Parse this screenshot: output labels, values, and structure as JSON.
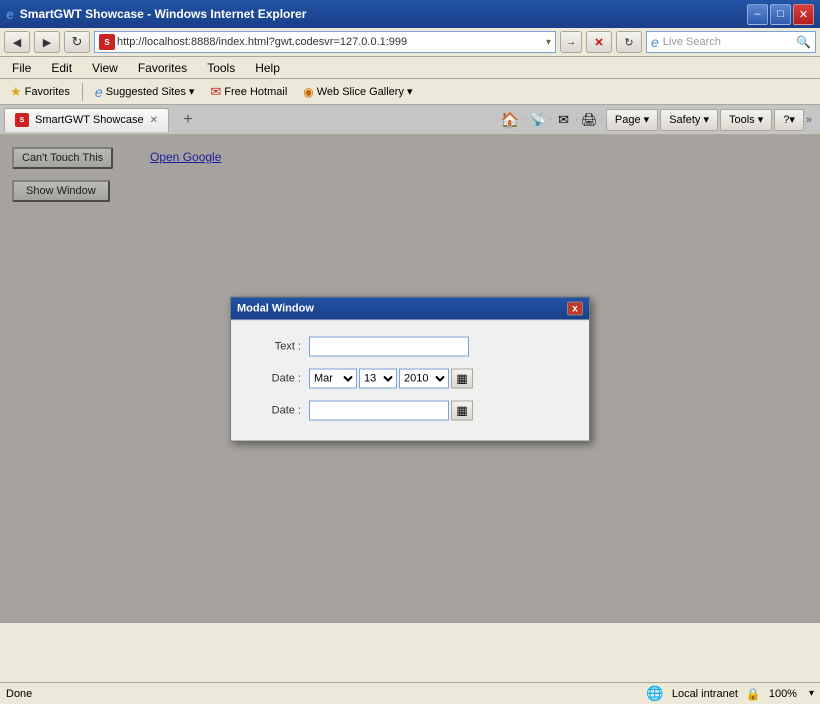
{
  "titlebar": {
    "title": "SmartGWT Showcase - Windows Internet Explorer",
    "controls": {
      "minimize": "–",
      "maximize": "□",
      "close": "✕"
    }
  },
  "addressbar": {
    "back_icon": "◀",
    "forward_icon": "▶",
    "refresh_icon": "↻",
    "url": "http://localhost:8888/index.html?gwt.codesvr=127.0.0.1:999",
    "search_placeholder": "Live Search",
    "go_icon": "🔍"
  },
  "menubar": {
    "items": [
      "File",
      "Edit",
      "View",
      "Favorites",
      "Tools",
      "Help"
    ]
  },
  "favoritesbar": {
    "favorites_label": "Favorites",
    "suggested_sites": "Suggested Sites ▾",
    "free_hotmail": "Free Hotmail",
    "web_slice_gallery": "Web Slice Gallery ▾"
  },
  "tab": {
    "label": "SmartGWT Showcase",
    "new_tab": "+"
  },
  "toolbar_buttons": [
    "Page ▾",
    "Safety ▾",
    "Tools ▾",
    "?▾"
  ],
  "page": {
    "cant_touch_label": "Can't Touch This",
    "open_google_label": "Open Google",
    "show_window_label": "Show Window"
  },
  "modal": {
    "title": "Modal Window",
    "close": "x",
    "text_label": "Text :",
    "date_label1": "Date :",
    "date_label2": "Date :",
    "month_options": [
      "Mar"
    ],
    "day_options": [
      "13"
    ],
    "year_options": [
      "2010"
    ],
    "month_value": "Mar",
    "day_value": "13",
    "year_value": "2010",
    "calendar_icon": "▦"
  },
  "statusbar": {
    "done_text": "Done",
    "intranet_icon": "🌐",
    "intranet_label": "Local intranet",
    "zoom_label": "100%"
  }
}
